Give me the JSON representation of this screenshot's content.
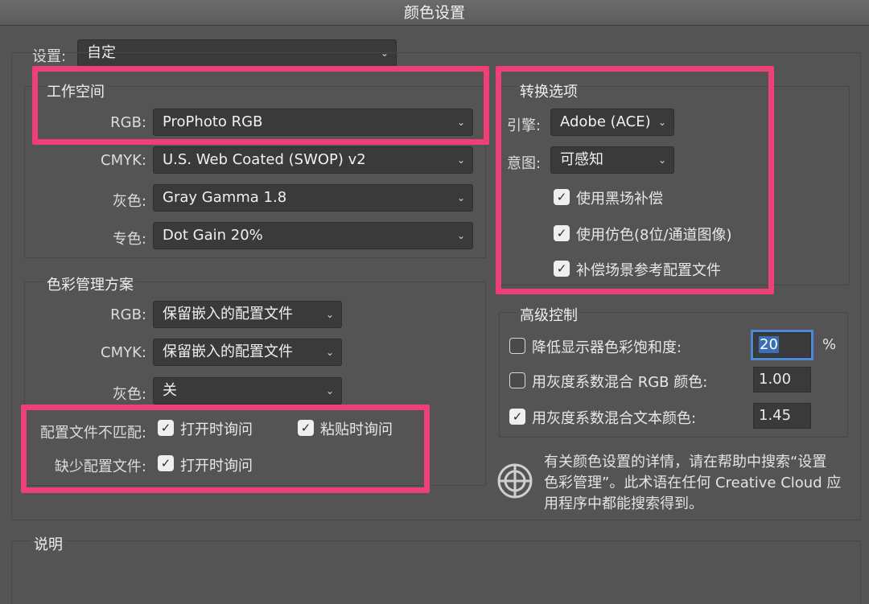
{
  "window": {
    "title": "颜色设置"
  },
  "settings": {
    "label": "设置:",
    "value": "自定"
  },
  "workspace": {
    "title": "工作空间",
    "rows": [
      {
        "label": "RGB:",
        "value": "ProPhoto RGB"
      },
      {
        "label": "CMYK:",
        "value": "U.S. Web Coated (SWOP) v2"
      },
      {
        "label": "灰色:",
        "value": "Gray Gamma 1.8"
      },
      {
        "label": "专色:",
        "value": "Dot Gain 20%"
      }
    ]
  },
  "policies": {
    "title": "色彩管理方案",
    "rows": [
      {
        "label": "RGB:",
        "value": "保留嵌入的配置文件"
      },
      {
        "label": "CMYK:",
        "value": "保留嵌入的配置文件"
      },
      {
        "label": "灰色:",
        "value": "关"
      }
    ],
    "mismatch_label": "配置文件不匹配:",
    "mismatch_open": "打开时询问",
    "mismatch_paste": "粘贴时询问",
    "missing_label": "缺少配置文件:",
    "missing_open": "打开时询问"
  },
  "conversion": {
    "title": "转换选项",
    "engine_label": "引擎:",
    "engine_value": "Adobe (ACE)",
    "intent_label": "意图:",
    "intent_value": "可感知",
    "black_point": "使用黑场补偿",
    "dither": "使用仿色(8位/通道图像)",
    "compensate": "补偿场景参考配置文件"
  },
  "advanced": {
    "title": "高级控制",
    "desaturate_label": "降低显示器色彩饱和度:",
    "desaturate_value": "20",
    "desaturate_unit": "%",
    "blend_rgb_label": "用灰度系数混合 RGB 颜色:",
    "blend_rgb_value": "1.00",
    "blend_text_label": "用灰度系数混合文本颜色:",
    "blend_text_value": "1.45"
  },
  "info": {
    "line1": "有关颜色设置的详情，请在帮助中搜索“设置",
    "line2": "色彩管理”。此术语在任何 Creative Cloud 应",
    "line3": "用程序中都能搜索得到。"
  },
  "description": {
    "title": "说明"
  },
  "colors": {
    "highlight": "#ee3f77",
    "background": "#545454"
  }
}
